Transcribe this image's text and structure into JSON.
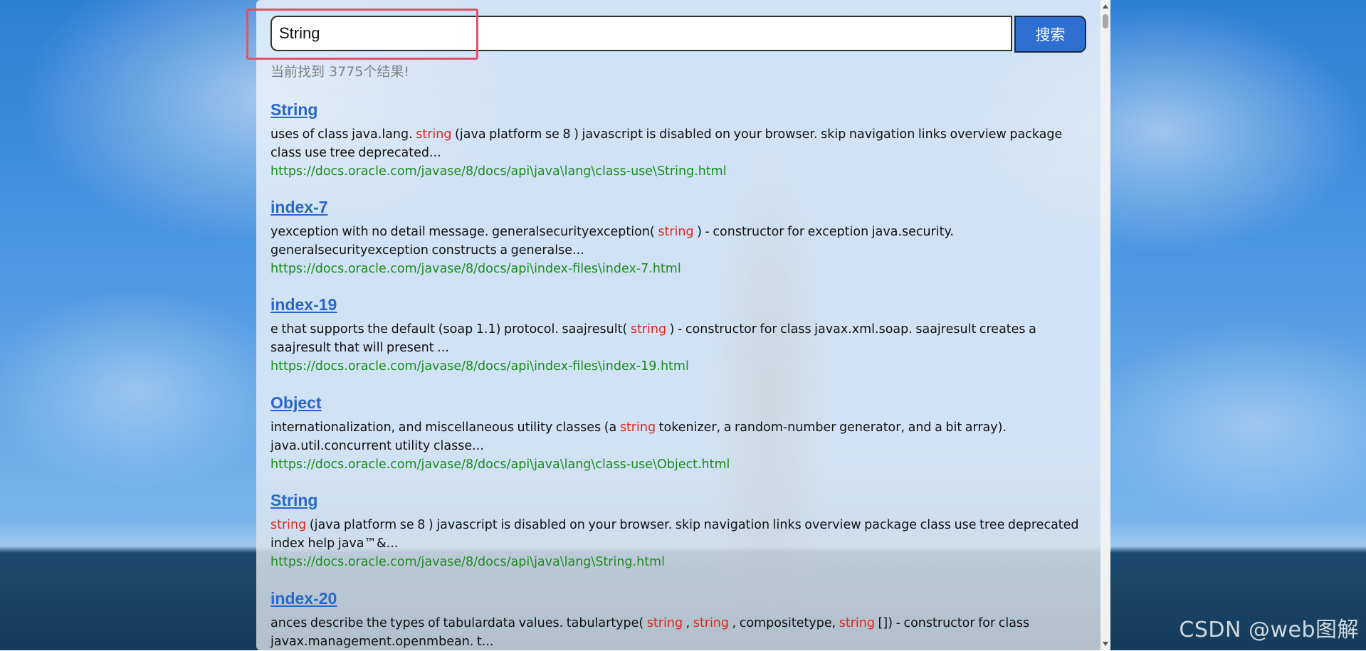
{
  "search": {
    "value": "String",
    "button_label": "搜索"
  },
  "result_count_text": "当前找到 3775个结果!",
  "results": [
    {
      "title": "String",
      "desc_segments": [
        {
          "text": "uses of class java.lang. ",
          "hl": false
        },
        {
          "text": "string",
          "hl": true
        },
        {
          "text": " (java platform se 8 ) javascript is disabled on your browser. skip navigation links overview package class use tree deprecated...",
          "hl": false
        }
      ],
      "url": "https://docs.oracle.com/javase/8/docs/api\\java\\lang\\class-use\\String.html"
    },
    {
      "title": "index-7",
      "desc_segments": [
        {
          "text": "yexception with no detail message. generalsecurityexception( ",
          "hl": false
        },
        {
          "text": "string",
          "hl": true
        },
        {
          "text": " ) - constructor for exception java.security. generalsecurityexception constructs a generalse...",
          "hl": false
        }
      ],
      "url": "https://docs.oracle.com/javase/8/docs/api\\index-files\\index-7.html"
    },
    {
      "title": "index-19",
      "desc_segments": [
        {
          "text": "e that supports the default (soap 1.1) protocol. saajresult( ",
          "hl": false
        },
        {
          "text": "string",
          "hl": true
        },
        {
          "text": " ) - constructor for class javax.xml.soap. saajresult creates a saajresult that will present ...",
          "hl": false
        }
      ],
      "url": "https://docs.oracle.com/javase/8/docs/api\\index-files\\index-19.html"
    },
    {
      "title": "Object",
      "desc_segments": [
        {
          "text": "internationalization, and miscellaneous utility classes (a ",
          "hl": false
        },
        {
          "text": "string",
          "hl": true
        },
        {
          "text": " tokenizer, a random-number generator, and a bit array). java.util.concurrent utility classe...",
          "hl": false
        }
      ],
      "url": "https://docs.oracle.com/javase/8/docs/api\\java\\lang\\class-use\\Object.html"
    },
    {
      "title": "String",
      "desc_segments": [
        {
          "text": "string",
          "hl": true
        },
        {
          "text": " (java platform se 8 ) javascript is disabled on your browser. skip navigation links overview package class use tree deprecated index help java™&...",
          "hl": false
        }
      ],
      "url": "https://docs.oracle.com/javase/8/docs/api\\java\\lang\\String.html"
    },
    {
      "title": "index-20",
      "desc_segments": [
        {
          "text": "ances describe the types of tabulardata values. tabulartype( ",
          "hl": false
        },
        {
          "text": "string",
          "hl": true
        },
        {
          "text": " , ",
          "hl": false
        },
        {
          "text": "string",
          "hl": true
        },
        {
          "text": " , compositetype, ",
          "hl": false
        },
        {
          "text": "string",
          "hl": true
        },
        {
          "text": " []) - constructor for class javax.management.openmbean. t...",
          "hl": false
        }
      ],
      "url": ""
    }
  ],
  "watermark": "CSDN @web图解",
  "colors": {
    "title_link": "#2a66c8",
    "keyword_highlight": "#e1241e",
    "url": "#1d8a1d",
    "button": "#2f6fd0",
    "annotation_box": "#e05266"
  }
}
